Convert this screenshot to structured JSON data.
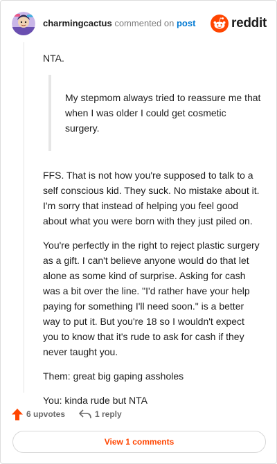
{
  "header": {
    "username": "charmingcactus",
    "action_text": "commented on",
    "post_link": "post",
    "logo_text": "reddit"
  },
  "comment": {
    "paragraphs_before_quote": [
      "NTA."
    ],
    "quote": "My stepmom always tried to reassure me that when I was older I could get cosmetic surgery.",
    "paragraphs_after_quote": [
      "FFS. That is not how you're supposed to talk to a self conscious kid. They suck. No mistake about it. I'm sorry that instead of helping you feel good about what you were born with they just piled on.",
      "You're perfectly in the right to reject plastic surgery as a gift. I can't believe anyone would do that let alone as some kind of surprise. Asking for cash was a bit over the line. \"I'd rather have your help paying for something I'll need soon.\" is a better way to put it. But you're 18 so I wouldn't expect you to know that it's rude to ask for cash if they never taught you.",
      "Them: great big gaping assholes",
      "You: kinda rude but NTA"
    ]
  },
  "actions": {
    "upvotes_label": "6 upvotes",
    "reply_label": "1 reply"
  },
  "view_comments_label": "View 1 comments",
  "colors": {
    "brand": "#ff4500",
    "link": "#0079d3",
    "muted": "#7c7c7c"
  },
  "icons": {
    "avatar": "avatar-icon",
    "logo": "reddit-logo-icon",
    "upvote": "upvote-arrow-icon",
    "reply": "reply-arrow-icon"
  }
}
